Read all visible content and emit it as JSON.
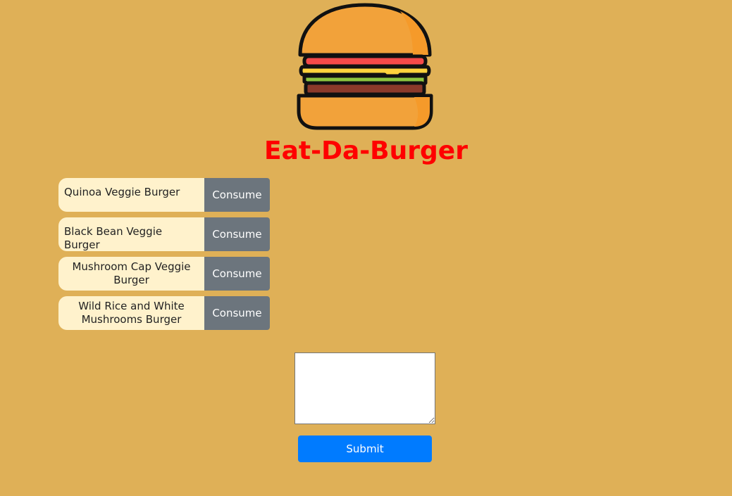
{
  "header": {
    "title": "Eat-Da-Burger",
    "logo_icon": "burger-icon"
  },
  "burgers": [
    {
      "name": "Quinoa Veggie Burger",
      "button_label": "Consume"
    },
    {
      "name": "Black Bean Veggie Burger",
      "button_label": "Consume"
    },
    {
      "name": "Mushroom Cap Veggie Burger",
      "button_label": "Consume"
    },
    {
      "name": "Wild Rice and White Mushrooms Burger",
      "button_label": "Consume"
    }
  ],
  "form": {
    "input_value": "",
    "submit_label": "Submit"
  },
  "colors": {
    "background": "#dfb057",
    "title": "#ff0000",
    "item_background": "#fff2cc",
    "consume_button": "#6c757d",
    "submit_button": "#007bff"
  }
}
